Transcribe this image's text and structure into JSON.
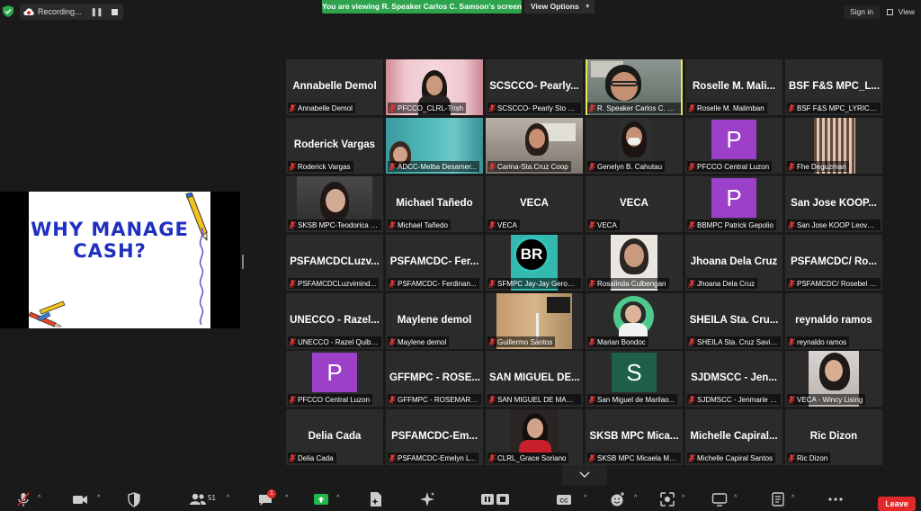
{
  "topbar": {
    "recording_label": "Recording...",
    "banner": "You are viewing R. Speaker Carlos C. Samson's screen",
    "view_options": "View Options",
    "sign_in": "Sign in",
    "view": "View"
  },
  "shared_screen": {
    "slide_title_line1": "WHY MANAGE",
    "slide_title_line2": "CASH?"
  },
  "tiles": [
    {
      "name": "Annabelle Demol",
      "label": "Annabelle Demol"
    },
    {
      "name": "",
      "label": "PFCCO_CLRL-Trish"
    },
    {
      "name": "SCSCCO- Pearly...",
      "label": "SCSCCO- Pearly Sto To..."
    },
    {
      "name": "",
      "label": "R. Speaker Carlos C. Sams..."
    },
    {
      "name": "Roselle M. Mali...",
      "label": "Roselle M. Malimban"
    },
    {
      "name": "BSF F&S MPC_L...",
      "label": "BSF F&S MPC_LYRICA ..."
    },
    {
      "name": "Roderick Vargas",
      "label": "Roderick Vargas"
    },
    {
      "name": "",
      "label": "ADCC-Melba Desamer..."
    },
    {
      "name": "",
      "label": "Carina-Sta.Cruz Coop"
    },
    {
      "name": "",
      "label": "Genelyn B. Cahutau"
    },
    {
      "name": "",
      "label": "PFCCO Central Luzon",
      "avatar": "P"
    },
    {
      "name": "",
      "label": "Fhe Deguzman"
    },
    {
      "name": "",
      "label": "SKSB MPC-Teodorica B..."
    },
    {
      "name": "Michael Tañedo",
      "label": "Michael Tañedo"
    },
    {
      "name": "VECA",
      "label": "VECA"
    },
    {
      "name": "VECA",
      "label": "VECA"
    },
    {
      "name": "",
      "label": "BBMPC Patrick Gepolio",
      "avatar": "P"
    },
    {
      "name": "San Jose KOOP...",
      "label": "San Jose KOOP Leovy ..."
    },
    {
      "name": "PSFAMCDCLuzv...",
      "label": "PSFAMCDCLuzvimind..."
    },
    {
      "name": "PSFAMCDC- Fer...",
      "label": "PSFAMCDC- Ferdinan..."
    },
    {
      "name": "",
      "label": "SFMPC Jay-Jay Geroni...",
      "logo": "BR"
    },
    {
      "name": "",
      "label": "Rosalinda Culbengan"
    },
    {
      "name": "Jhoana Dela Cruz",
      "label": "Jhoana Dela Cruz"
    },
    {
      "name": "PSFAMCDC/ Ro...",
      "label": "PSFAMCDC/ Rosebel B..."
    },
    {
      "name": "UNECCO - Razel...",
      "label": "UNECCO - Razel Quibr..."
    },
    {
      "name": "Maylene demol",
      "label": "Maylene demol"
    },
    {
      "name": "",
      "label": "Guillermo Santos"
    },
    {
      "name": "",
      "label": "Marian Bondoc"
    },
    {
      "name": "SHEILA Sta. Cru...",
      "label": "SHEILA Sta. Cruz Savin..."
    },
    {
      "name": "reynaldo ramos",
      "label": "reynaldo ramos"
    },
    {
      "name": "",
      "label": "PFCCO Central Luzon",
      "avatar": "P"
    },
    {
      "name": "GFFMPC - ROSE...",
      "label": "GFFMPC - ROSEMARIE..."
    },
    {
      "name": "SAN MIGUEL DE...",
      "label": "SAN MIGUEL DE MARI..."
    },
    {
      "name": "",
      "label": "San Miguel de Marilao...",
      "avatar": "S"
    },
    {
      "name": "SJDMSCC - Jen...",
      "label": "SJDMSCC - Jenmarie E..."
    },
    {
      "name": "",
      "label": "VECA - Wincy Lising"
    },
    {
      "name": "Delia Cada",
      "label": "Delia Cada"
    },
    {
      "name": "PSFAMCDC-Em...",
      "label": "PSFAMCDC-Emelyn L..."
    },
    {
      "name": "",
      "label": "CLRL_Grace Soriano"
    },
    {
      "name": "SKSB MPC Mica...",
      "label": "SKSB MPC Micaela Ma..."
    },
    {
      "name": "Michelle Capiral...",
      "label": "Michelle Capiral Santos"
    },
    {
      "name": "Ric Dizon",
      "label": "Ric Dizon"
    }
  ],
  "toolbar": {
    "participants_count": "51",
    "chat_badge": "1",
    "leave": "Leave"
  },
  "colors": {
    "banner_green": "#2ea44f",
    "leave_red": "#e02828",
    "active_speaker_border": "#e4e85a",
    "avatar_purple": "#9c3fc9",
    "avatar_green": "#1d5f4b"
  }
}
